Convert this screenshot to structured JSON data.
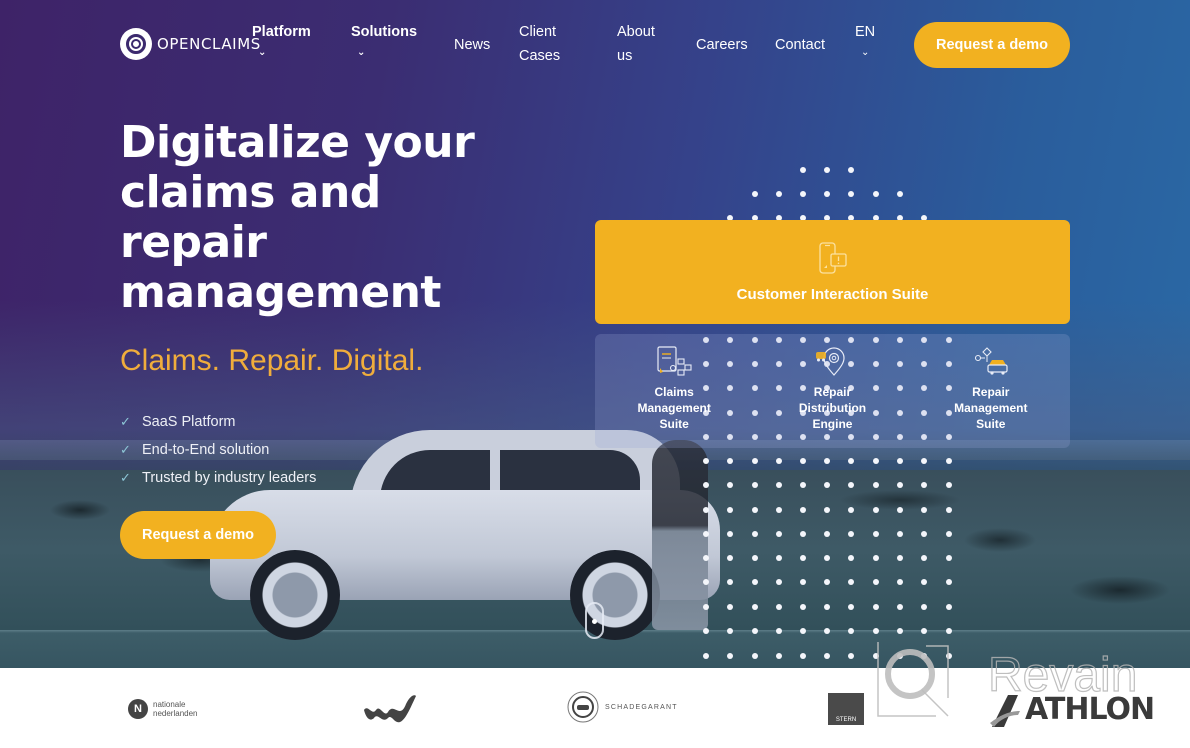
{
  "brand": {
    "name": "OPENCLAIMS",
    "primary_color": "#f2b120",
    "tagline_color": "#f0ad3c"
  },
  "nav": {
    "items": [
      {
        "label": "Platform",
        "has_dropdown": true,
        "bold": true
      },
      {
        "label": "Solutions",
        "has_dropdown": true,
        "bold": true
      },
      {
        "label": "News",
        "has_dropdown": false,
        "bold": false
      },
      {
        "label": "Client Cases",
        "has_dropdown": false,
        "bold": false
      },
      {
        "label": "About us",
        "has_dropdown": false,
        "bold": false
      },
      {
        "label": "Careers",
        "has_dropdown": false,
        "bold": false
      },
      {
        "label": "Contact",
        "has_dropdown": false,
        "bold": false
      }
    ],
    "client_cases_line1": "Client",
    "client_cases_line2": "Cases",
    "about_line1": "About",
    "about_line2": "us",
    "language": "EN",
    "cta_label": "Request a demo",
    "chevron_glyph": "⌄"
  },
  "hero": {
    "headline": "Digitalize your claims and repair management",
    "headline_lines": [
      "Digitalize your",
      "claims and",
      "repair",
      "management"
    ],
    "tagline": "Claims. Repair. Digital.",
    "features": [
      "SaaS Platform",
      "End-to-End solution",
      "Trusted by industry leaders"
    ],
    "check_glyph": "✓",
    "cta_label": "Request a demo"
  },
  "products": {
    "main": {
      "label": "Customer Interaction Suite",
      "icon": "phone-chat-icon"
    },
    "suites": [
      {
        "label": "Claims Management Suite",
        "icon": "document-flowchart-icon"
      },
      {
        "label": "Repair Distribution Engine",
        "icon": "location-gear-icon"
      },
      {
        "label": "Repair Management Suite",
        "icon": "car-flowchart-icon"
      }
    ]
  },
  "clients": [
    {
      "name": "nationale nederlanden",
      "line1": "nationale",
      "line2": "nederlanden"
    },
    {
      "name": "LeasePlan"
    },
    {
      "name": "SCHADEGARANT"
    },
    {
      "name": "STERN"
    },
    {
      "name": "ATHLON"
    }
  ],
  "watermark": {
    "text": "Revain"
  }
}
